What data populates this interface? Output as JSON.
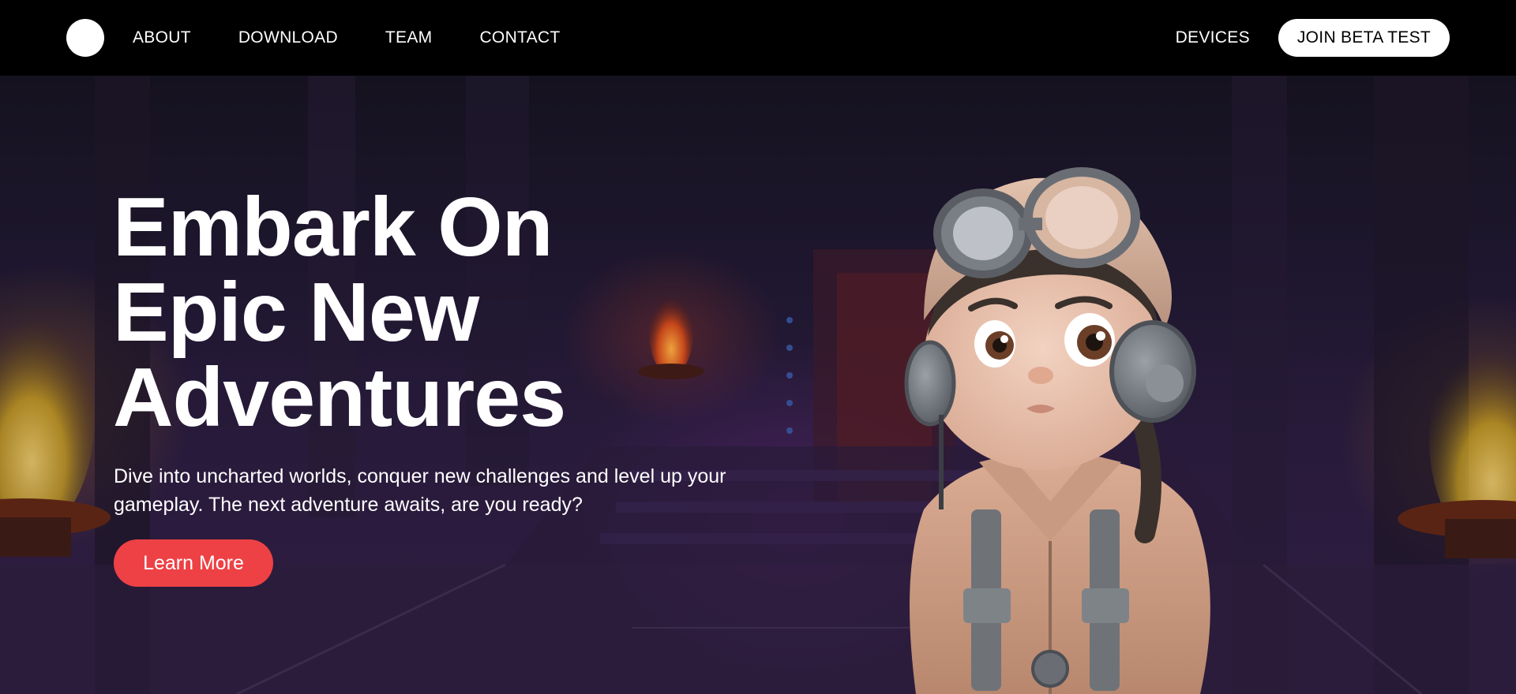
{
  "nav": {
    "links": [
      "ABOUT",
      "DOWNLOAD",
      "TEAM",
      "CONTACT"
    ],
    "devices_label": "DEVICES",
    "beta_label": "JOIN BETA TEST"
  },
  "hero": {
    "title_lines": [
      "Embark On",
      "Epic New",
      "Adventures"
    ],
    "subtitle": "Dive into uncharted worlds, conquer new challenges and level up your gameplay. The next adventure awaits, are you ready?",
    "cta_label": "Learn More"
  },
  "colors": {
    "navbar_bg": "#000000",
    "cta_bg": "#ee4145",
    "beta_bg": "#ffffff",
    "hero_bg": "#1f1730"
  },
  "icons": {
    "logo": "white-circle-logo",
    "character": "aviator-girl-character"
  }
}
